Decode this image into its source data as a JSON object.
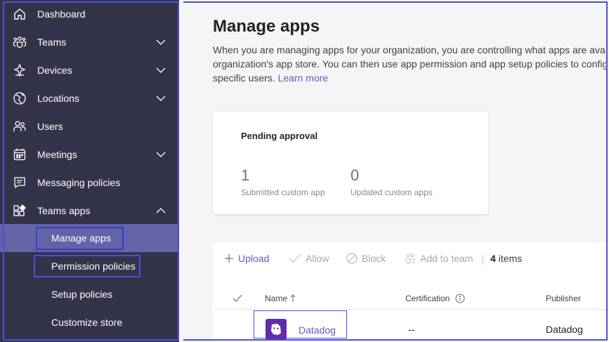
{
  "sidebar": {
    "items": [
      {
        "label": "Dashboard",
        "icon": "home-icon",
        "expandable": false
      },
      {
        "label": "Teams",
        "icon": "teams-icon",
        "expandable": true
      },
      {
        "label": "Devices",
        "icon": "devices-icon",
        "expandable": true
      },
      {
        "label": "Locations",
        "icon": "globe-icon",
        "expandable": true
      },
      {
        "label": "Users",
        "icon": "users-icon",
        "expandable": false
      },
      {
        "label": "Meetings",
        "icon": "calendar-icon",
        "expandable": true
      },
      {
        "label": "Messaging policies",
        "icon": "message-icon",
        "expandable": false
      },
      {
        "label": "Teams apps",
        "icon": "apps-icon",
        "expandable": true,
        "expanded": true
      }
    ],
    "sub_items": [
      {
        "label": "Manage apps",
        "active": true
      },
      {
        "label": "Permission policies",
        "active": false
      },
      {
        "label": "Setup policies",
        "active": false
      },
      {
        "label": "Customize store",
        "active": false
      }
    ]
  },
  "main": {
    "title": "Manage apps",
    "description_lines": [
      "When you are managing apps for your organization, you are controlling what apps are ava",
      "organization's app store. You can then use app permission and app setup policies to config",
      "specific users."
    ],
    "learn_more": "Learn more",
    "pending_card": {
      "title": "Pending approval",
      "stats": [
        {
          "value": "1",
          "label": "Submitted custom app"
        },
        {
          "value": "0",
          "label": "Updated custom apps"
        }
      ]
    },
    "toolbar": {
      "upload": "Upload",
      "allow": "Allow",
      "block": "Block",
      "add_to_team": "Add to team",
      "count": "4",
      "count_suffix": "items"
    },
    "table": {
      "columns": [
        "Name",
        "Certification",
        "Publisher"
      ],
      "rows": [
        {
          "name": "Datadog",
          "certification": "--",
          "publisher": "Datadog"
        }
      ]
    }
  },
  "colors": {
    "sidebar_bg": "#33344a",
    "active_bg": "#6264a7",
    "accent": "#5b5fc7",
    "highlight_border": "#4b4fd6",
    "app_icon_bg": "#632ca6"
  }
}
